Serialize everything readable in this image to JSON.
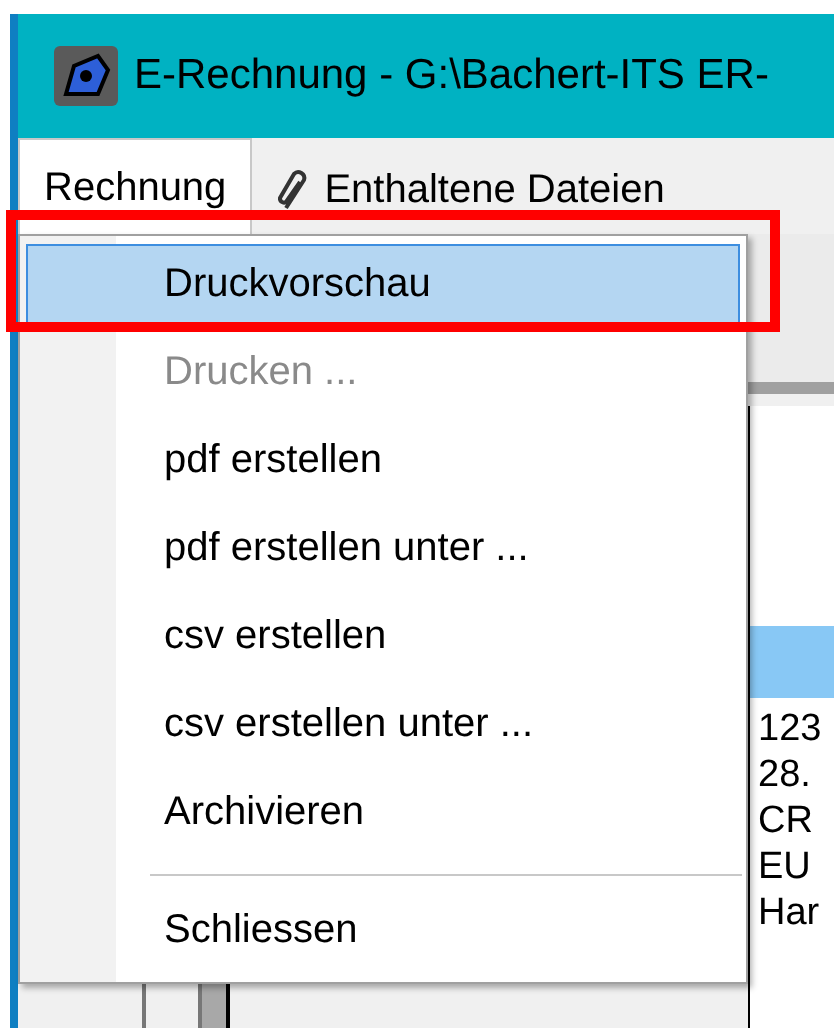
{
  "window": {
    "title": "E-Rechnung - G:\\Bachert-ITS ER-"
  },
  "menu_bar": [
    {
      "label": "Rechnung",
      "selected": true,
      "kind": "plain"
    },
    {
      "label": "Enthaltene Dateien",
      "selected": false,
      "kind": "attachment"
    }
  ],
  "dropdown": [
    {
      "kind": "item",
      "label": "Druckvorschau",
      "selected": true,
      "disabled": false
    },
    {
      "kind": "item",
      "label": "Drucken ...",
      "selected": false,
      "disabled": true
    },
    {
      "kind": "item",
      "label": "pdf erstellen",
      "selected": false,
      "disabled": false
    },
    {
      "kind": "item",
      "label": "pdf erstellen unter ...",
      "selected": false,
      "disabled": false
    },
    {
      "kind": "item",
      "label": "csv erstellen",
      "selected": false,
      "disabled": false
    },
    {
      "kind": "item",
      "label": "csv erstellen unter ...",
      "selected": false,
      "disabled": false
    },
    {
      "kind": "item",
      "label": "Archivieren",
      "selected": false,
      "disabled": false
    },
    {
      "kind": "separator"
    },
    {
      "kind": "item",
      "label": "Schliessen",
      "selected": false,
      "disabled": false
    }
  ],
  "details_values": [
    "123",
    "28.",
    "CR",
    "EU",
    "Har"
  ]
}
